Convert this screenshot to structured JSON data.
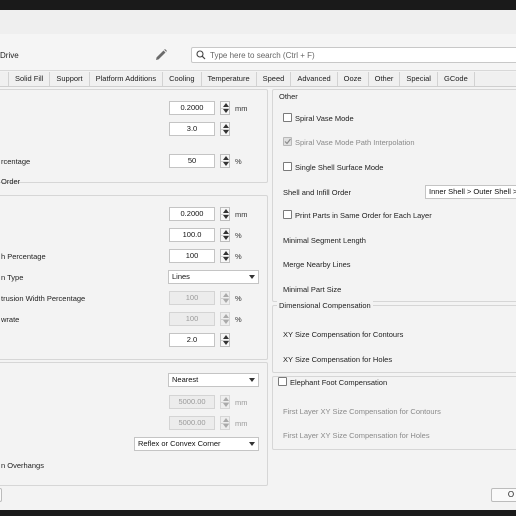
{
  "header": {
    "preset_name": "Drive",
    "search_placeholder": "Type here to search (Ctrl + F)"
  },
  "tabs": [
    "Solid Fill",
    "Support",
    "Platform Additions",
    "Cooling",
    "Temperature",
    "Speed",
    "Advanced",
    "Ooze",
    "Other",
    "Special",
    "GCode"
  ],
  "left": {
    "g1": {
      "r1": {
        "value": "0.2000",
        "unit": "mm"
      },
      "r2": {
        "value": "3.0"
      },
      "r3": {
        "label": "rcentage",
        "value": "50",
        "unit": "%"
      },
      "r4": {
        "label": "Order"
      }
    },
    "g2": {
      "r1": {
        "value": "0.2000",
        "unit": "mm"
      },
      "r2": {
        "value": "100.0",
        "unit": "%"
      },
      "r3": {
        "label": "h Percentage",
        "value": "100",
        "unit": "%"
      },
      "r4": {
        "label": "n Type",
        "value": "Lines"
      },
      "r5": {
        "label": "trusion Width Percentage",
        "value": "100",
        "unit": "%"
      },
      "r6": {
        "label": "wrate",
        "value": "100",
        "unit": "%"
      },
      "r7": {
        "value": "2.0"
      }
    },
    "g3": {
      "r1": {
        "value": "Nearest"
      },
      "r2": {
        "value": "5000.00",
        "unit": "mm"
      },
      "r3": {
        "value": "5000.00",
        "unit": "mm"
      },
      "r4": {
        "value": "Reflex or Convex Corner"
      },
      "r5": {
        "label": "n Overhangs"
      }
    }
  },
  "right": {
    "other": {
      "title": "Other",
      "spiral_vase": "Spiral Vase Mode",
      "spiral_interp": "Spiral Vase Mode Path Interpolation",
      "single_shell": "Single Shell Surface Mode",
      "shell_infill_label": "Shell and Infill Order",
      "shell_infill_value": "Inner Shell > Outer Shell >",
      "print_parts": "Print Parts in Same Order for Each Layer",
      "min_segment": "Minimal Segment Length",
      "merge_lines": "Merge Nearby Lines",
      "min_part": "Minimal Part Size"
    },
    "dim": {
      "title": "Dimensional Compensation",
      "xy_contours": "XY Size Compensation for Contours",
      "xy_holes": "XY Size Compensation for Holes"
    },
    "elephant": {
      "title": "Elephant Foot Compensation",
      "first_contours": "First Layer XY Size Compensation for Contours",
      "first_holes": "First Layer XY Size Compensation for Holes"
    }
  },
  "footer": {
    "ok_label": "O"
  }
}
